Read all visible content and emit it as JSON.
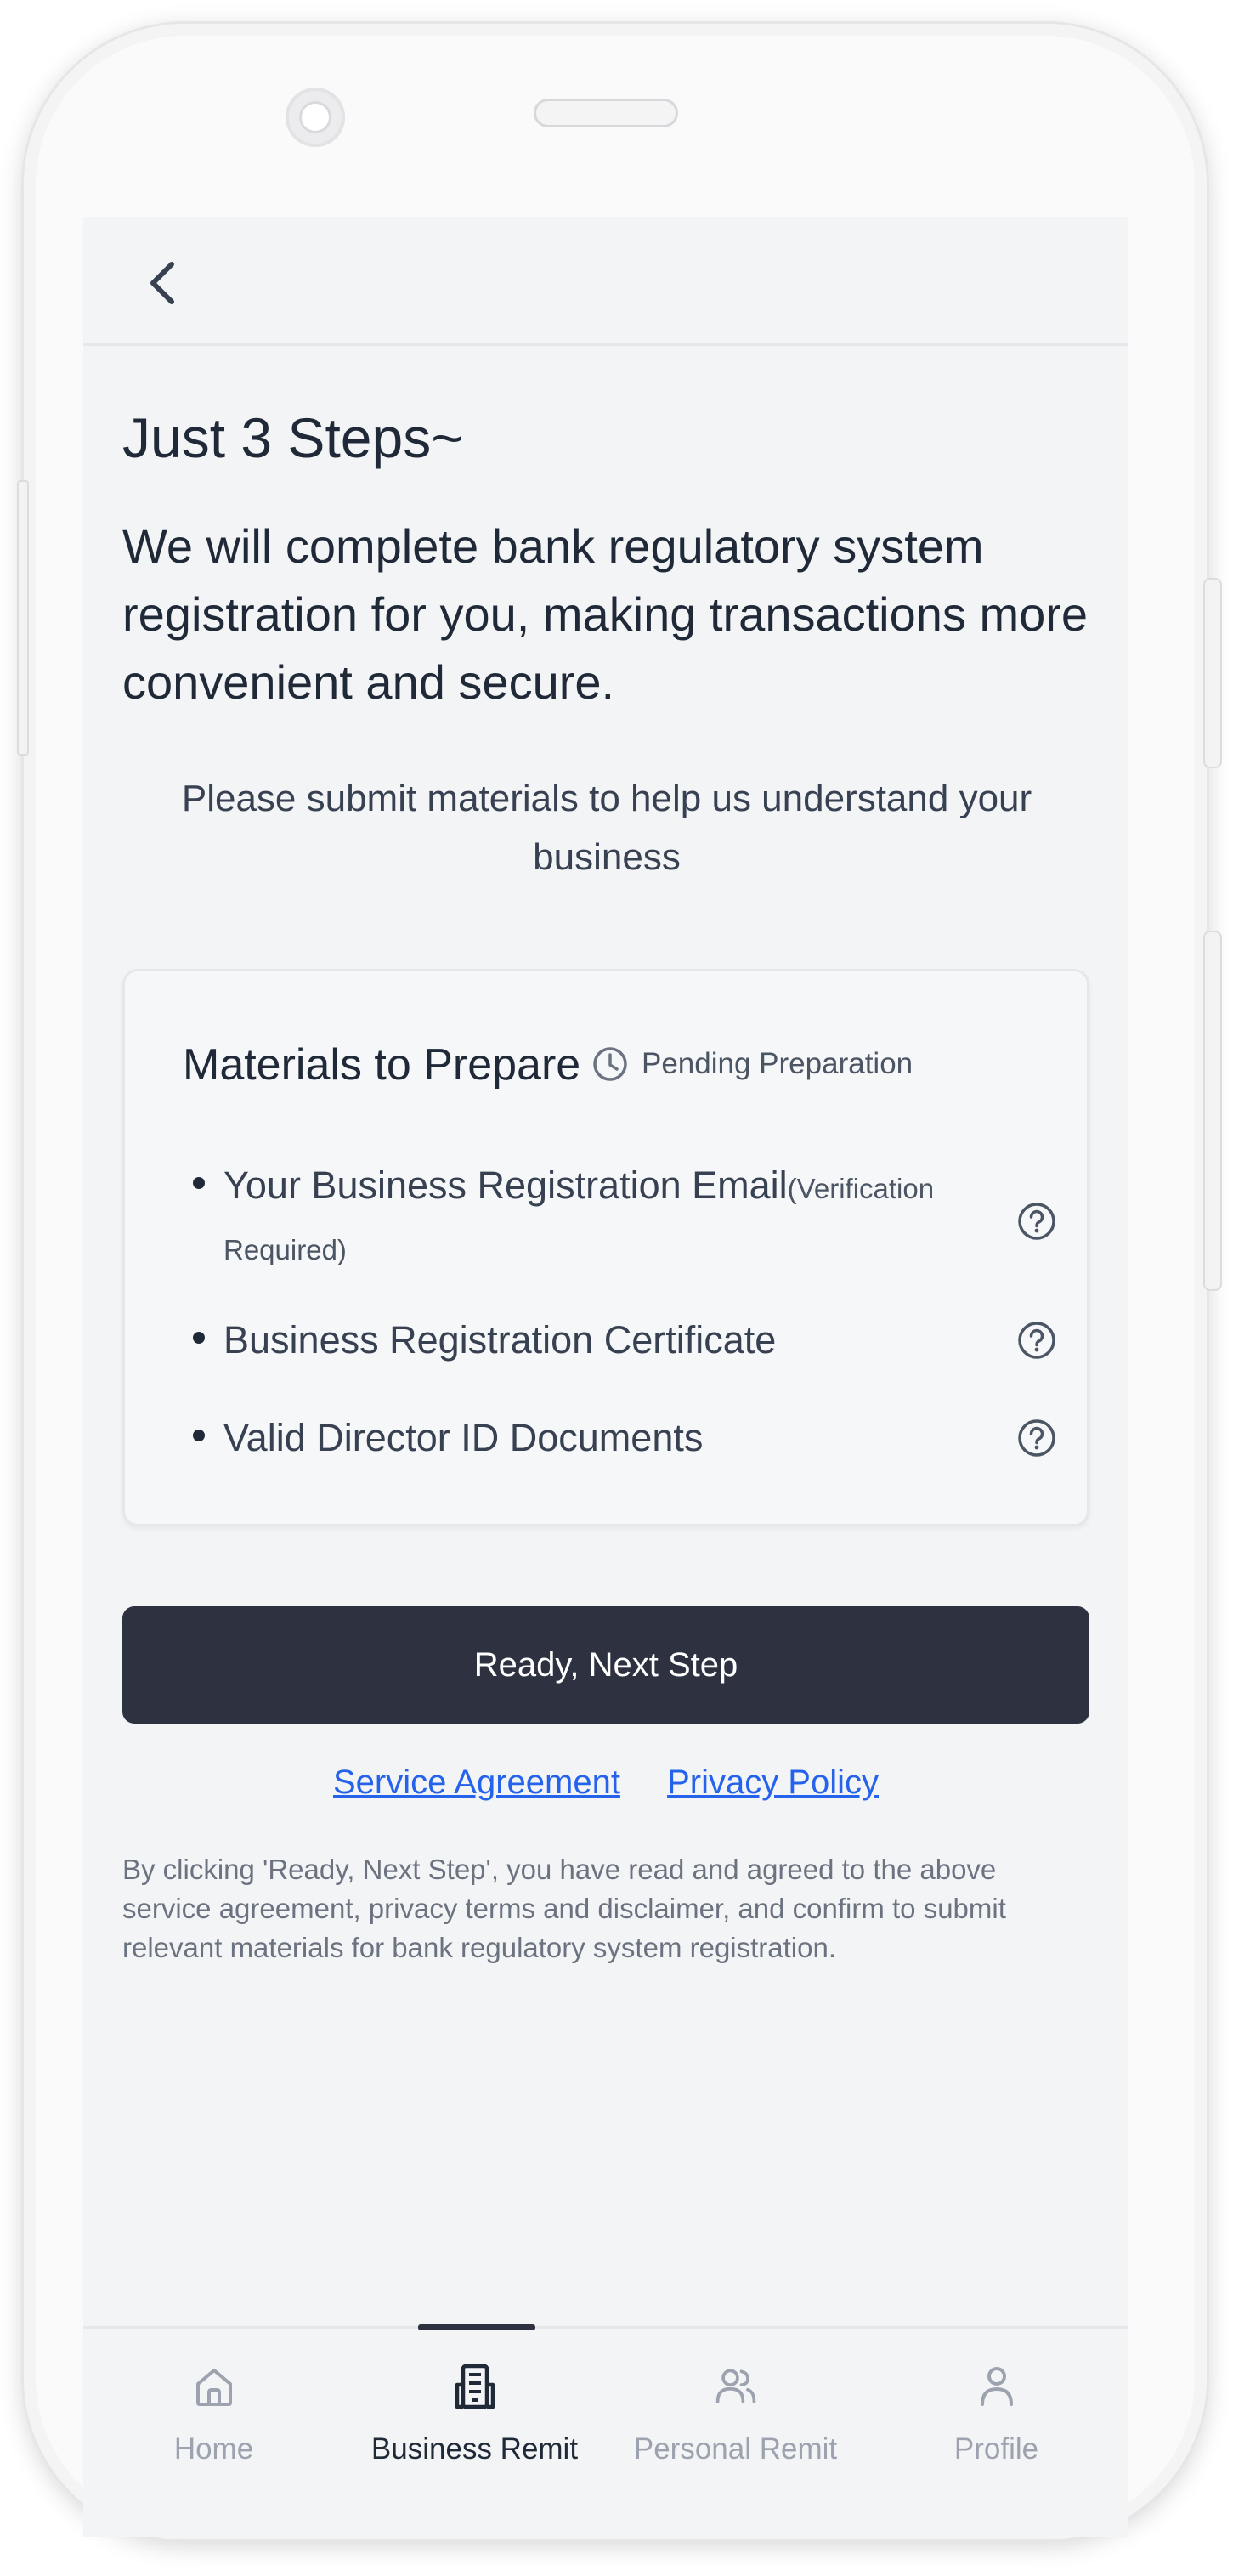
{
  "header": {
    "back_icon": "chevron-left-icon"
  },
  "intro": {
    "title": "Just 3 Steps~",
    "subtitle": "We will complete bank regulatory system registration for you, making transactions more convenient and secure.",
    "prompt": "Please submit materials to help us understand your business"
  },
  "materials": {
    "title": "Materials to Prepare",
    "status": "Pending Preparation",
    "status_icon": "clock-icon",
    "items": [
      {
        "label": "Your Business Registration Email",
        "note": "(Verification Required)",
        "help_icon": "question-circle-icon"
      },
      {
        "label": "Business Registration Certificate",
        "note": "",
        "help_icon": "question-circle-icon"
      },
      {
        "label": "Valid Director ID Documents",
        "note": "",
        "help_icon": "question-circle-icon"
      }
    ]
  },
  "actions": {
    "primary_label": "Ready, Next Step",
    "links": [
      "Service Agreement",
      "Privacy Policy"
    ],
    "disclaimer": "By clicking 'Ready, Next Step', you have read and agreed to the above service agreement, privacy terms and disclaimer, and confirm to submit relevant materials for bank regulatory system registration."
  },
  "tabbar": {
    "active_index": 1,
    "tabs": [
      {
        "label": "Home",
        "icon": "home-icon"
      },
      {
        "label": "Business Remit",
        "icon": "building-icon"
      },
      {
        "label": "Personal Remit",
        "icon": "users-icon"
      },
      {
        "label": "Profile",
        "icon": "user-icon"
      }
    ]
  },
  "colors": {
    "screen_bg": "#f3f4f6",
    "primary_button": "#2d3140",
    "link": "#2563eb",
    "text_dark": "#1f2937",
    "text_muted": "#6b7280",
    "tab_inactive": "#9ca3af"
  }
}
